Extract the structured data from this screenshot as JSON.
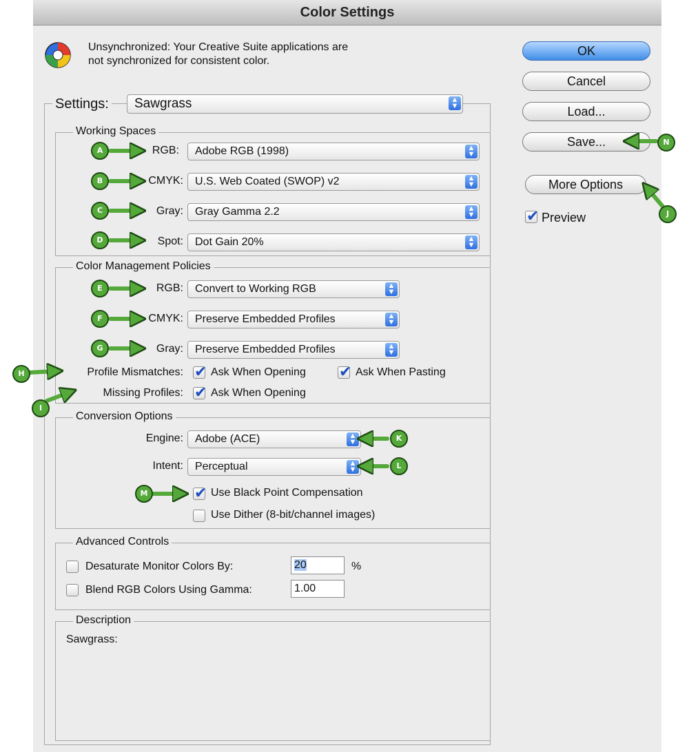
{
  "window": {
    "title": "Color Settings"
  },
  "sync": {
    "message_line1": "Unsynchronized: Your Creative Suite applications are",
    "message_line2": "not synchronized for consistent color."
  },
  "settings": {
    "label": "Settings:",
    "value": "Sawgrass"
  },
  "working_spaces": {
    "legend": "Working Spaces",
    "rgb": {
      "label": "RGB:",
      "value": "Adobe RGB (1998)"
    },
    "cmyk": {
      "label": "CMYK:",
      "value": "U.S. Web Coated (SWOP) v2"
    },
    "gray": {
      "label": "Gray:",
      "value": "Gray Gamma 2.2"
    },
    "spot": {
      "label": "Spot:",
      "value": "Dot Gain 20%"
    }
  },
  "policies": {
    "legend": "Color Management Policies",
    "rgb": {
      "label": "RGB:",
      "value": "Convert to Working RGB"
    },
    "cmyk": {
      "label": "CMYK:",
      "value": "Preserve Embedded Profiles"
    },
    "gray": {
      "label": "Gray:",
      "value": "Preserve Embedded Profiles"
    },
    "mismatch_label": "Profile Mismatches:",
    "ask_opening": "Ask When Opening",
    "ask_pasting": "Ask When Pasting",
    "missing_label": "Missing Profiles:",
    "missing_ask_opening": "Ask When Opening"
  },
  "conversion": {
    "legend": "Conversion Options",
    "engine": {
      "label": "Engine:",
      "value": "Adobe (ACE)"
    },
    "intent": {
      "label": "Intent:",
      "value": "Perceptual"
    },
    "black_point": "Use Black Point Compensation",
    "dither": "Use Dither (8-bit/channel images)"
  },
  "advanced": {
    "legend": "Advanced Controls",
    "desaturate_label": "Desaturate Monitor Colors By:",
    "desaturate_value": "20",
    "desaturate_unit": "%",
    "blend_label": "Blend RGB Colors Using Gamma:",
    "blend_value": "1.00"
  },
  "description": {
    "legend": "Description",
    "text": "Sawgrass:"
  },
  "buttons": {
    "ok": "OK",
    "cancel": "Cancel",
    "load": "Load...",
    "save": "Save...",
    "more_options": "More Options"
  },
  "preview": {
    "label": "Preview",
    "checked": true
  },
  "checkbox_states": {
    "ask_opening": true,
    "ask_pasting": true,
    "missing_ask_opening": true,
    "black_point": true,
    "dither": false,
    "desaturate": false,
    "blend": false
  },
  "callouts": [
    "A",
    "B",
    "C",
    "D",
    "E",
    "F",
    "G",
    "H",
    "I",
    "J",
    "K",
    "L",
    "M",
    "N"
  ],
  "colors": {
    "callout_green": "#55a93b",
    "callout_outline": "#1d4a12",
    "ok_blue": "#3f8de8",
    "popup_arrow_blue": "#2f6fe0"
  }
}
